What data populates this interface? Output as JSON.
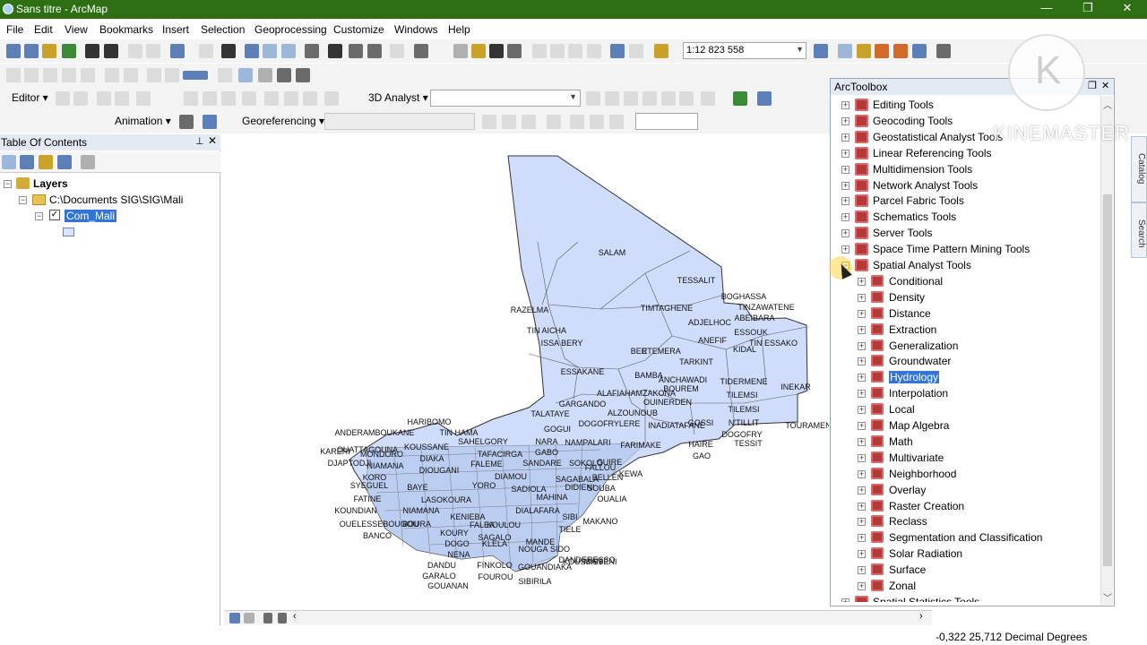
{
  "window": {
    "title": "Sans titre - ArcMap",
    "controls": [
      "—",
      "❐",
      "✕"
    ]
  },
  "menu": [
    "File",
    "Edit",
    "View",
    "Bookmarks",
    "Insert",
    "Selection",
    "Geoprocessing",
    "Customize",
    "Windows",
    "Help"
  ],
  "toolbar": {
    "scale": "1:12 823 558",
    "editor_label": "Editor ▾",
    "analyst_3d_label": "3D Analyst ▾",
    "animation_label": "Animation ▾",
    "georeferencing_label": "Georeferencing ▾"
  },
  "toc": {
    "title": "Table Of Contents",
    "layers_label": "Layers",
    "folder_label": "C:\\Documents SIG\\SIG\\Mali",
    "layer_label": "Com_Mali"
  },
  "arctoolbox": {
    "title": "ArcToolbox",
    "top_items": [
      "Editing Tools",
      "Geocoding Tools",
      "Geostatistical Analyst Tools",
      "Linear Referencing Tools",
      "Multidimension Tools",
      "Network Analyst Tools",
      "Parcel Fabric Tools",
      "Schematics Tools",
      "Server Tools",
      "Space Time Pattern Mining Tools",
      "Spatial Analyst Tools"
    ],
    "spatial_children": [
      "Conditional",
      "Density",
      "Distance",
      "Extraction",
      "Generalization",
      "Groundwater",
      "Hydrology",
      "Interpolation",
      "Local",
      "Map Algebra",
      "Math",
      "Multivariate",
      "Neighborhood",
      "Overlay",
      "Raster Creation",
      "Reclass",
      "Segmentation and Classification",
      "Solar Radiation",
      "Surface",
      "Zonal"
    ],
    "selected": "Hydrology",
    "last_item": "Spatial Statistics Tools"
  },
  "map_labels": [
    "SALAM",
    "TESSALIT",
    "BOGHASSA",
    "TINZAWATENE",
    "ABEIBARA",
    "RAZELMA",
    "TIMTAGHENE",
    "ADJELHOC",
    "ESSOUK",
    "TIN AICHA",
    "ANEFIF",
    "TIN ESSAKO",
    "ISSA BERY",
    "BER",
    "ETEMERA",
    "KIDAL",
    "TARKINT",
    "ESSAKANE",
    "BAMBA",
    "ANCHAWADI",
    "TIDERMENE",
    "INEKAR",
    "BOUREM",
    "TILEMSI",
    "ALAFIAHAMZAKONA",
    "GARGANDO",
    "OUINERDEN",
    "TILEMSI",
    "TALATAYE",
    "ALZOUNOUB",
    "HARIBOMO",
    "GOGUI",
    "DOGOFRYLERE",
    "INADIATAFANE",
    "GOSSI",
    "N'TILLIT",
    "TIN HAMA",
    "DOGOFRY",
    "TOURAMENAKA",
    "ANDERAMBOUKANE",
    "SAHELGORY",
    "NARA",
    "NAMPALARI",
    "FARIMAKE",
    "HAIRE",
    "GAO",
    "TESSIT",
    "OUATTAGOUNA",
    "KOUSSANE",
    "GABO",
    "KARERI",
    "MONDORO",
    "TAFACIRGA",
    "SANDARE",
    "GUIRE",
    "SOKOLO",
    "DJAPTODJI",
    "DIAKA",
    "FALEME",
    "FALLOU",
    "NIAMANA",
    "DIOUGANI",
    "DIAMOU",
    "SAGABALA",
    "BELLEN",
    "KEWA",
    "KORO",
    "YORO",
    "SADIOLA",
    "DIDIENI",
    "SOUBA",
    "SYEGUEL",
    "BAYE",
    "MAHINA",
    "OUALIA",
    "FATINE",
    "LASOKOURA",
    "DIALAFARA",
    "KOUNDIAN",
    "NIAMANA",
    "KENIEBA",
    "MAKANO",
    "SIBI",
    "OUELESSEBOUGOU",
    "BOURA",
    "FALEA",
    "KOULOU",
    "TIELE",
    "BANCO",
    "KOURY",
    "SAGALO",
    "MANDE",
    "DOGO",
    "KLELA",
    "NOUGA",
    "SIDO",
    "NENA",
    "DANDERESSO",
    "DANDU",
    "FINKOLO",
    "GOUANDIAKA",
    "GARALO",
    "FOUROU",
    "GOUANAN",
    "SIBIRILA",
    "KOUSSAN",
    "MISSENI"
  ],
  "status": {
    "coordinates": "-0,322  25,712 Decimal Degrees"
  },
  "watermark": "KINEMASTER"
}
